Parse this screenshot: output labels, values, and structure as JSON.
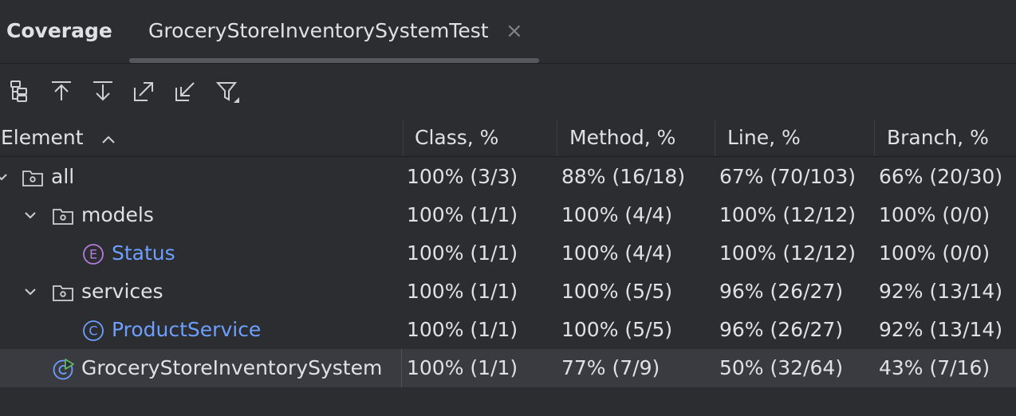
{
  "panel": {
    "title": "Coverage"
  },
  "tab": {
    "label": "GroceryStoreInventorySystemTest",
    "close_glyph": "×"
  },
  "toolbar": {
    "icons": [
      "tree-flatten-icon",
      "navigate-up-icon",
      "navigate-down-icon",
      "export-icon",
      "import-icon",
      "filter-icon"
    ]
  },
  "columns": {
    "element": "Element",
    "class": "Class, %",
    "method": "Method, %",
    "line": "Line, %",
    "branch": "Branch, %"
  },
  "rows": [
    {
      "name": "all",
      "icon": "package-folder-icon",
      "class": "100% (3/3)",
      "method": "88% (16/18)",
      "line": "67% (70/103)",
      "branch": "66% (20/30)"
    },
    {
      "name": "models",
      "icon": "package-folder-icon",
      "class": "100% (1/1)",
      "method": "100% (4/4)",
      "line": "100% (12/12)",
      "branch": "100% (0/0)"
    },
    {
      "name": "Status",
      "icon": "enum-icon",
      "icon_letter": "E",
      "class": "100% (1/1)",
      "method": "100% (4/4)",
      "line": "100% (12/12)",
      "branch": "100% (0/0)"
    },
    {
      "name": "services",
      "icon": "package-folder-icon",
      "class": "100% (1/1)",
      "method": "100% (5/5)",
      "line": "96% (26/27)",
      "branch": "92% (13/14)"
    },
    {
      "name": "ProductService",
      "icon": "class-icon",
      "icon_letter": "C",
      "class": "100% (1/1)",
      "method": "100% (5/5)",
      "line": "96% (26/27)",
      "branch": "92% (13/14)"
    },
    {
      "name": "GroceryStoreInventorySystem",
      "icon": "runnable-class-icon",
      "class": "100% (1/1)",
      "method": "77% (7/9)",
      "line": "50% (32/64)",
      "branch": "43% (7/16)",
      "selected": true
    }
  ],
  "colors": {
    "background": "#2b2d30",
    "selected_row": "#393b40",
    "link": "#6e9fff",
    "enum_icon": "#b57bde",
    "class_icon": "#6e9fff",
    "run_badge": "#5fb865"
  }
}
